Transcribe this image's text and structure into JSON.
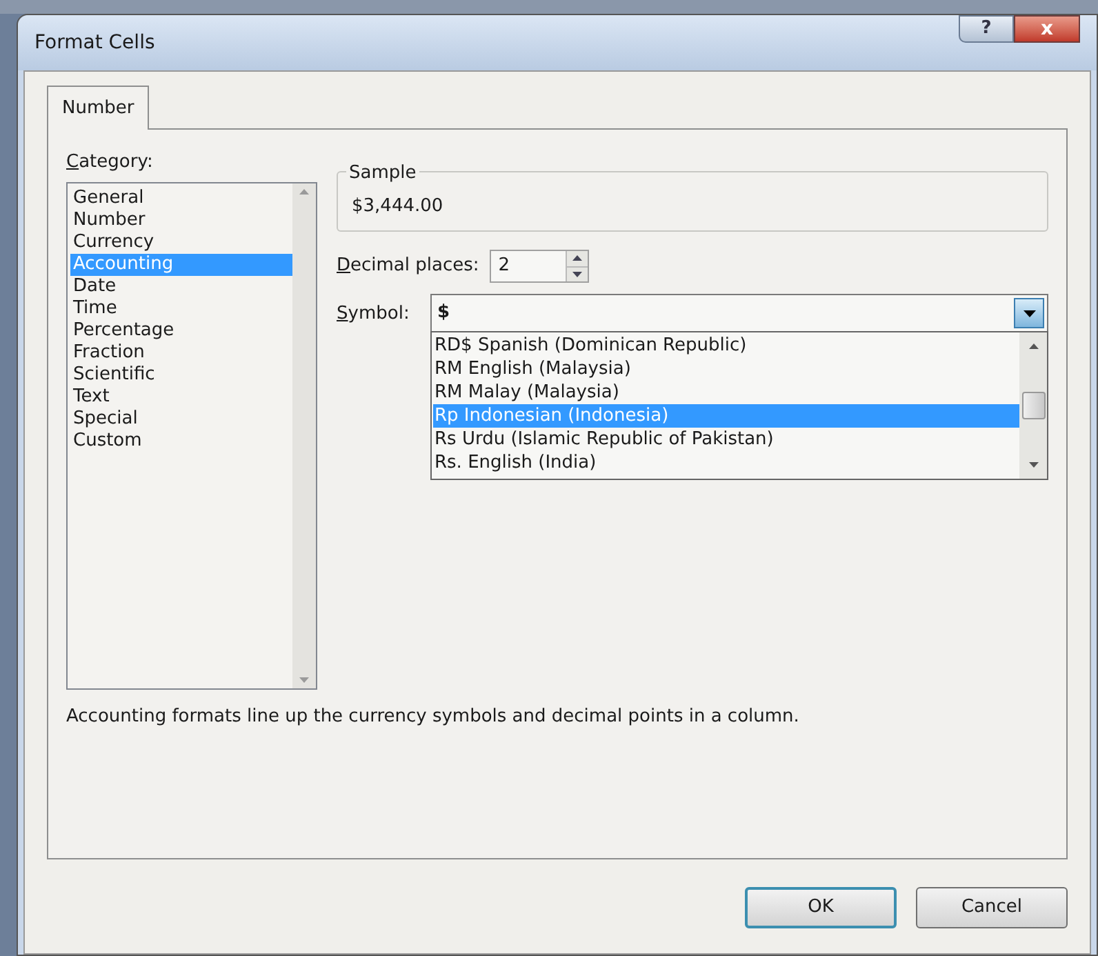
{
  "window": {
    "title": "Format Cells",
    "buttons": [
      {
        "kind": "help",
        "label": "?"
      },
      {
        "kind": "close",
        "label": "x"
      }
    ]
  },
  "tabs": [
    {
      "label": "Number",
      "selected": true
    }
  ],
  "category": {
    "label": {
      "access_key": "C",
      "rest": "ategory:"
    },
    "items": [
      {
        "label": "General",
        "selected": false
      },
      {
        "label": "Number",
        "selected": false
      },
      {
        "label": "Currency",
        "selected": false
      },
      {
        "label": "Accounting",
        "selected": true
      },
      {
        "label": "Date",
        "selected": false
      },
      {
        "label": "Time",
        "selected": false
      },
      {
        "label": "Percentage",
        "selected": false
      },
      {
        "label": "Fraction",
        "selected": false
      },
      {
        "label": "Scientific",
        "selected": false
      },
      {
        "label": "Text",
        "selected": false
      },
      {
        "label": "Special",
        "selected": false
      },
      {
        "label": "Custom",
        "selected": false
      }
    ]
  },
  "sample": {
    "label": "Sample",
    "value": "$3,444.00"
  },
  "decimal_places": {
    "label": {
      "access_key": "D",
      "rest": "ecimal places:"
    },
    "value": "2"
  },
  "symbol": {
    "label": {
      "access_key": "S",
      "rest": "ymbol:"
    },
    "value": "$",
    "expanded": true,
    "options": [
      {
        "label": "RD$ Spanish (Dominican Republic)",
        "selected": false
      },
      {
        "label": "RM English (Malaysia)",
        "selected": false
      },
      {
        "label": "RM Malay (Malaysia)",
        "selected": false
      },
      {
        "label": "Rp Indonesian (Indonesia)",
        "selected": true
      },
      {
        "label": "Rs Urdu (Islamic Republic of Pakistan)",
        "selected": false
      },
      {
        "label": "Rs. English (India)",
        "selected": false
      }
    ]
  },
  "description": "Accounting formats line up the currency symbols and decimal points in a column.",
  "buttons": [
    {
      "label": "OK",
      "default": true
    },
    {
      "label": "Cancel",
      "default": false
    }
  ]
}
